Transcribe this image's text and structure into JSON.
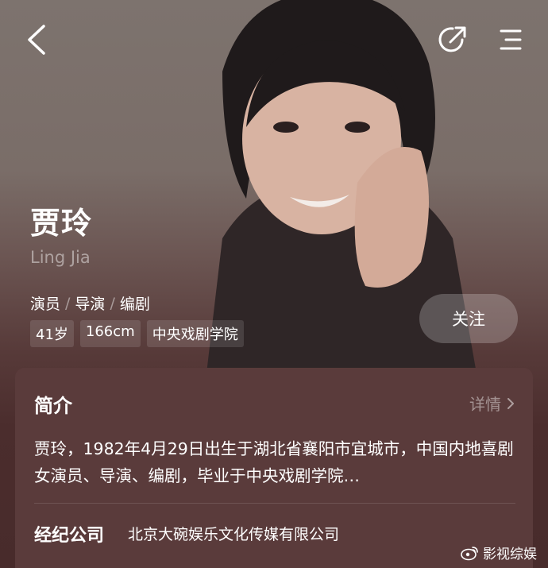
{
  "profile": {
    "name": "贾玲",
    "name_en": "Ling Jia",
    "roles": [
      "演员",
      "导演",
      "编剧"
    ],
    "role_sep": "/",
    "tags": [
      "41岁",
      "166cm",
      "中央戏剧学院"
    ],
    "follow_label": "关注"
  },
  "intro": {
    "title": "简介",
    "more_label": "详情",
    "text": "贾玲，1982年4月29日出生于湖北省襄阳市宜城市，中国内地喜剧女演员、导演、编剧，毕业于中央戏剧学院"
  },
  "agency": {
    "label": "经纪公司",
    "value": "北京大碗娱乐文化传媒有限公司"
  },
  "watermark": {
    "text": "影视综娱"
  },
  "icons": {
    "back": "chevron-left-icon",
    "share": "share-icon",
    "menu": "menu-icon",
    "more": "chevron-right-icon",
    "watermark": "weibo-icon"
  }
}
